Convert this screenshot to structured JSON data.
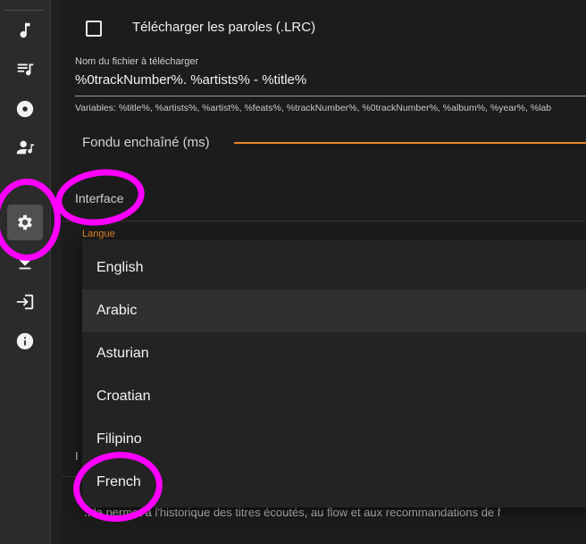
{
  "sidebar": {
    "items": [
      {
        "name": "nav-tracks",
        "icon": "music-note-icon"
      },
      {
        "name": "nav-playlists",
        "icon": "playlist-icon"
      },
      {
        "name": "nav-albums",
        "icon": "disc-icon"
      },
      {
        "name": "nav-artists",
        "icon": "artist-icon"
      },
      {
        "name": "nav-settings",
        "icon": "gear-icon",
        "active": true
      },
      {
        "name": "nav-downloads",
        "icon": "download-icon"
      },
      {
        "name": "nav-login",
        "icon": "login-icon"
      },
      {
        "name": "nav-about",
        "icon": "info-icon"
      }
    ]
  },
  "settings": {
    "lrc_checkbox_label": "Télécharger les paroles (.LRC)",
    "filename": {
      "label": "Nom du fichier à télécharger",
      "value": "%0trackNumber%. %artists% - %title%",
      "hint": "Variables: %title%, %artists%, %artist%, %feats%, %trackNumber%, %0trackNumber%, %album%, %year%, %lab"
    },
    "crossfade_label": "Fondu enchaîné (ms)",
    "interface_title": "Interface",
    "language_label": "Langue",
    "hidden_row_letter": "I",
    "bottom_text": "...la permet à l'historique des titres écoutés, au flow et aux recommandations de f"
  },
  "language_dropdown": {
    "options": [
      "English",
      "Arabic",
      "Asturian",
      "Croatian",
      "Filipino",
      "French"
    ],
    "highlighted": "Arabic"
  },
  "colors": {
    "accent": "#e8832a",
    "annotation": "#ff00ff"
  }
}
